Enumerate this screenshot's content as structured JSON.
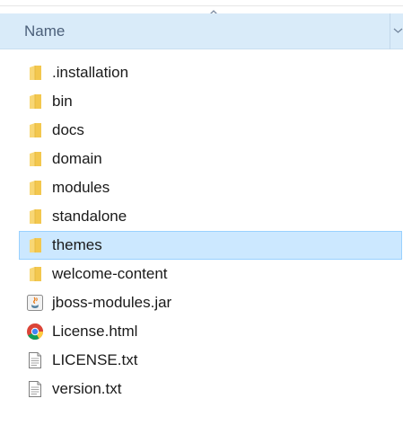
{
  "header": {
    "column_name": "Name",
    "sort": "ascending"
  },
  "files": [
    {
      "name": ".installation",
      "icon": "folder-icon"
    },
    {
      "name": "bin",
      "icon": "folder-icon"
    },
    {
      "name": "docs",
      "icon": "folder-icon"
    },
    {
      "name": "domain",
      "icon": "folder-icon"
    },
    {
      "name": "modules",
      "icon": "folder-icon"
    },
    {
      "name": "standalone",
      "icon": "folder-icon"
    },
    {
      "name": "themes",
      "icon": "folder-icon",
      "selected": true
    },
    {
      "name": "welcome-content",
      "icon": "folder-icon"
    },
    {
      "name": "jboss-modules.jar",
      "icon": "java-jar-icon"
    },
    {
      "name": "License.html",
      "icon": "chrome-html-icon"
    },
    {
      "name": "LICENSE.txt",
      "icon": "text-file-icon"
    },
    {
      "name": "version.txt",
      "icon": "text-file-icon"
    }
  ],
  "colors": {
    "header_bg": "#d9ebf9",
    "selection_bg": "#cce8ff",
    "selection_border": "#99d1ff",
    "folder": "#f8d775"
  }
}
